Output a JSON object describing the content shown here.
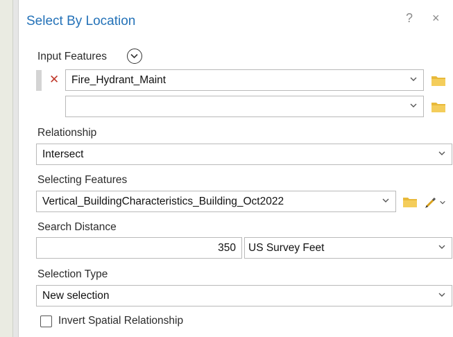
{
  "dialog": {
    "title": "Select By Location",
    "help_label": "?",
    "close_label": "×"
  },
  "input_features": {
    "label": "Input Features",
    "rows": [
      {
        "value": "Fire_Hydrant_Maint"
      },
      {
        "value": ""
      }
    ]
  },
  "relationship": {
    "label": "Relationship",
    "value": "Intersect"
  },
  "selecting_features": {
    "label": "Selecting Features",
    "value": "Vertical_BuildingCharacteristics_Building_Oct2022"
  },
  "search_distance": {
    "label": "Search Distance",
    "value": "350",
    "unit": "US Survey Feet"
  },
  "selection_type": {
    "label": "Selection Type",
    "value": "New selection"
  },
  "invert": {
    "label": "Invert Spatial Relationship",
    "checked": false
  },
  "colors": {
    "title_blue": "#2472b8",
    "folder_yellow": "#e8b93a",
    "remove_red": "#c0392b"
  },
  "icons": [
    "chevron-down-icon",
    "folder-icon",
    "remove-icon",
    "expand-icon",
    "pencil-icon"
  ]
}
